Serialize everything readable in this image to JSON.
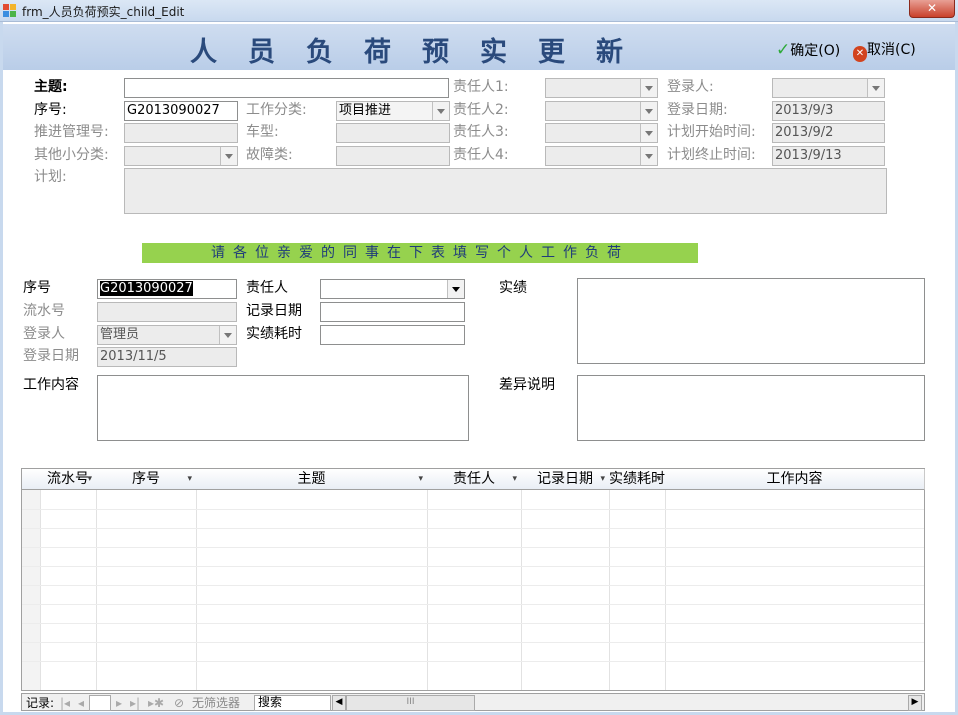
{
  "window": {
    "title": "frm_人员负荷预实_child_Edit",
    "close_label": "✕"
  },
  "header": {
    "title": "人员负荷预实更新",
    "confirm_label": "确定(O)",
    "cancel_label": "取消(C)"
  },
  "top_form": {
    "subject_label": "主题:",
    "subject_value": "",
    "seq_label": "序号:",
    "seq_value": "G2013090027",
    "progress_mgmt_label": "推进管理号:",
    "progress_mgmt_value": "",
    "other_cat_label": "其他小分类:",
    "other_cat_value": "",
    "plan_label": "计划:",
    "plan_value": "",
    "work_type_label": "工作分类:",
    "work_type_value": "项目推进",
    "car_type_label": "车型:",
    "car_type_value": "",
    "fault_type_label": "故障类:",
    "fault_type_value": "",
    "owner1_label": "责任人1:",
    "owner2_label": "责任人2:",
    "owner3_label": "责任人3:",
    "owner4_label": "责任人4:",
    "login_user_label": "登录人:",
    "login_user_value": "",
    "login_date_label": "登录日期:",
    "login_date_value": "2013/9/3",
    "plan_start_label": "计划开始时间:",
    "plan_start_value": "2013/9/2",
    "plan_end_label": "计划终止时间:",
    "plan_end_value": "2013/9/13"
  },
  "banner": {
    "text": "请各位亲爱的同事在下表填写个人工作负荷"
  },
  "detail_form": {
    "seq_label": "序号",
    "seq_value": "G2013090027",
    "serial_label": "流水号",
    "serial_value": "",
    "login_user_label": "登录人",
    "login_user_value": "管理员",
    "login_date_label": "登录日期",
    "login_date_value": "2013/11/5",
    "owner_label": "责任人",
    "owner_value": "",
    "record_date_label": "记录日期",
    "record_date_value": "",
    "actual_hours_label": "实绩耗时",
    "actual_hours_value": "",
    "actual_label": "实绩",
    "actual_value": "",
    "diff_label": "差异说明",
    "diff_value": "",
    "work_content_label": "工作内容",
    "work_content_value": ""
  },
  "grid": {
    "columns": [
      "流水号",
      "序号",
      "主题",
      "责任人",
      "记录日期",
      "实绩耗时",
      "工作内容"
    ]
  },
  "navbar": {
    "record_label": "记录:",
    "no_filter_label": "无筛选器",
    "search_label": "搜索"
  },
  "colors": {
    "header_bg": "#c4d6ee",
    "title_color": "#2a4a7c",
    "banner_bg": "#96d24e",
    "banner_text": "#1f3c7a"
  }
}
